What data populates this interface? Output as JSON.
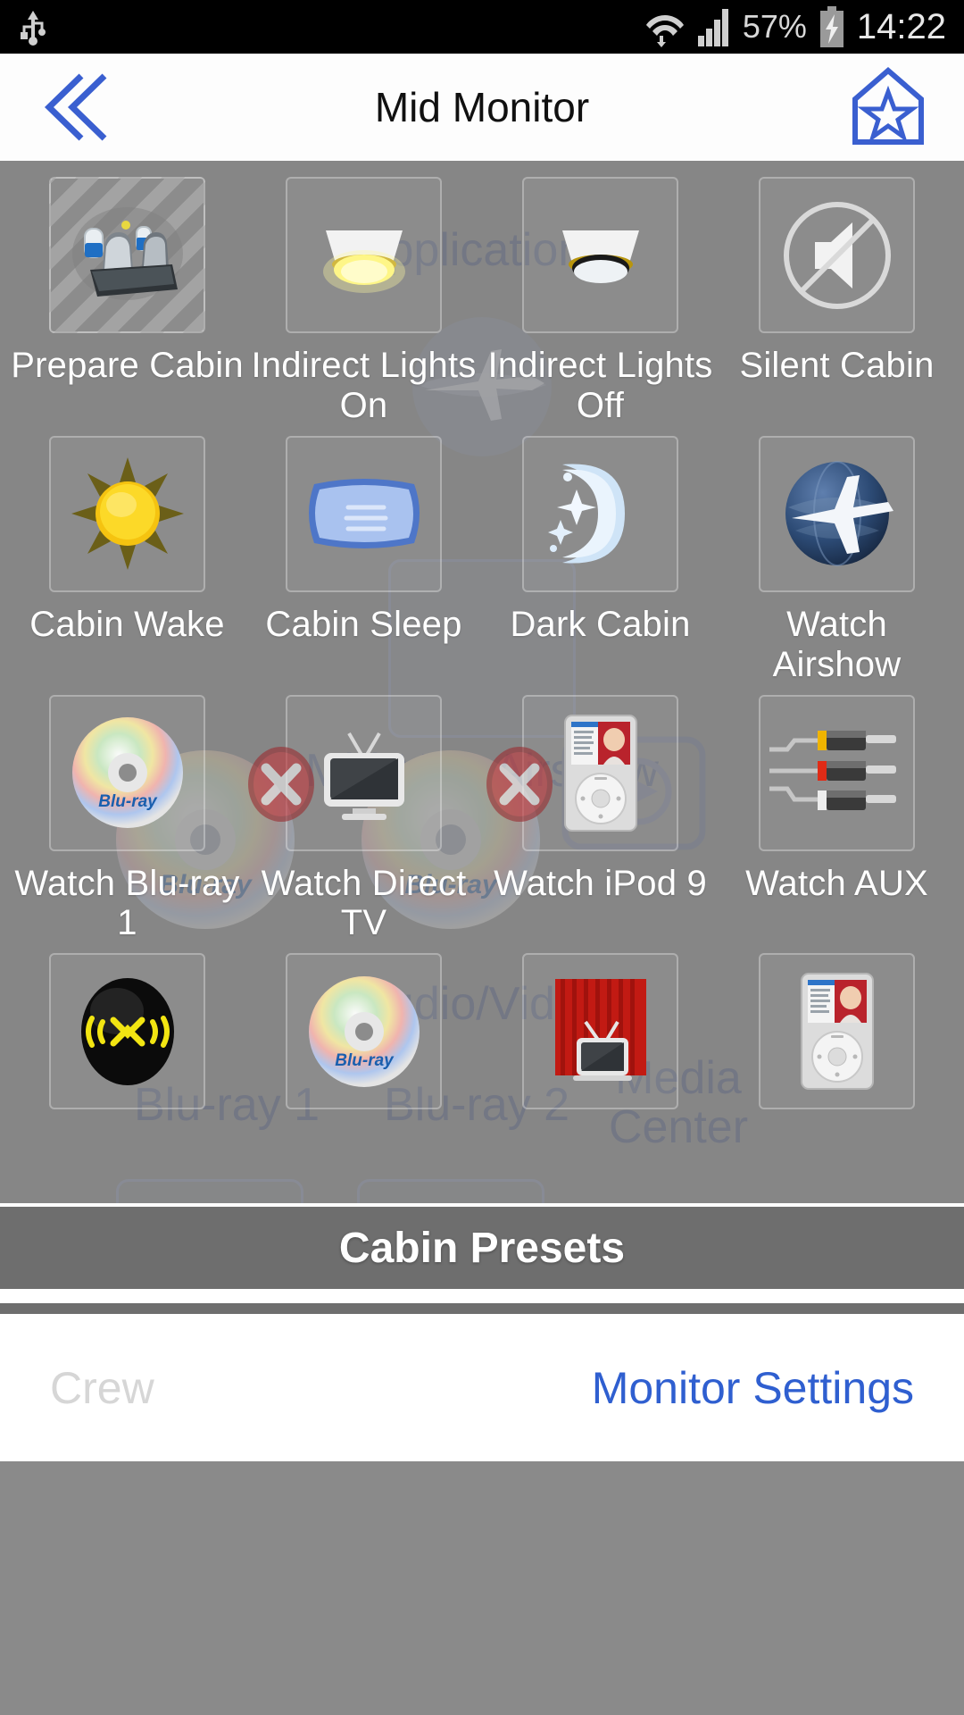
{
  "statusbar": {
    "usb_icon": "usb-icon",
    "wifi_icon": "wifi-icon",
    "signal_icon": "cellular-signal-icon",
    "battery_percent": "57%",
    "battery_icon": "battery-charging-icon",
    "time": "14:22"
  },
  "header": {
    "back_icon": "back-chevron-icon",
    "title": "Mid Monitor",
    "favorite_icon": "favorite-star-icon"
  },
  "ghost_layer": {
    "note": "faded previous screen showing through",
    "cells": [
      {
        "label": "Applications",
        "icon": "airplane-globe-icon"
      },
      {
        "label": "Mid Mon Airshow",
        "icon": "airshow-tile-icon"
      },
      {
        "label": "Audio/Video",
        "icon": "audio-video-icon"
      },
      {
        "label": "Blu-ray 1",
        "icon": "bluray-disc-icon"
      },
      {
        "label": "Blu-ray 2",
        "icon": "bluray-disc-icon"
      },
      {
        "label": "Media Center",
        "icon": "media-center-icon"
      }
    ]
  },
  "grid": {
    "rows": [
      {
        "cells": [
          {
            "label": "Prepare Cabin",
            "icon": "cabin-seats-icon",
            "striped": true
          },
          {
            "label": "Indirect Lights On",
            "icon": "ceiling-light-on-icon",
            "striped": false
          },
          {
            "label": "Indirect Lights Off",
            "icon": "ceiling-light-off-icon",
            "striped": false
          },
          {
            "label": "Silent Cabin",
            "icon": "mute-speaker-icon",
            "striped": false
          }
        ]
      },
      {
        "cells": [
          {
            "label": "Cabin Wake",
            "icon": "sun-icon",
            "striped": false
          },
          {
            "label": "Cabin Sleep",
            "icon": "pillow-icon",
            "striped": false
          },
          {
            "label": "Dark Cabin",
            "icon": "moon-stars-icon",
            "striped": false
          },
          {
            "label": "Watch Airshow",
            "icon": "airplane-globe-icon",
            "striped": false
          }
        ]
      },
      {
        "cells": [
          {
            "label": "Watch Blu-ray 1",
            "icon": "bluray-disc-icon",
            "striped": false
          },
          {
            "label": "Watch Direct TV",
            "icon": "television-icon",
            "striped": false
          },
          {
            "label": "Watch iPod 9",
            "icon": "ipod-icon",
            "striped": false
          },
          {
            "label": "Watch AUX",
            "icon": "rca-cables-icon",
            "striped": false
          }
        ]
      },
      {
        "cells": [
          {
            "label": "",
            "icon": "xm-radio-icon",
            "striped": false
          },
          {
            "label": "",
            "icon": "bluray-disc-icon",
            "striped": false
          },
          {
            "label": "",
            "icon": "theater-tv-icon",
            "striped": false
          },
          {
            "label": "",
            "icon": "ipod-icon",
            "striped": false
          }
        ]
      }
    ]
  },
  "presets": {
    "label": "Cabin Presets"
  },
  "bottom_nav": {
    "left_label": "Crew",
    "right_label": "Monitor Settings"
  },
  "colors": {
    "accent_blue": "#2f5fd0",
    "content_bg": "#868686",
    "presets_bg": "#6e6e6e",
    "ghost_text": "#4a5580",
    "label_white": "#ffffff",
    "disabled_gray": "#d6d6d6"
  }
}
